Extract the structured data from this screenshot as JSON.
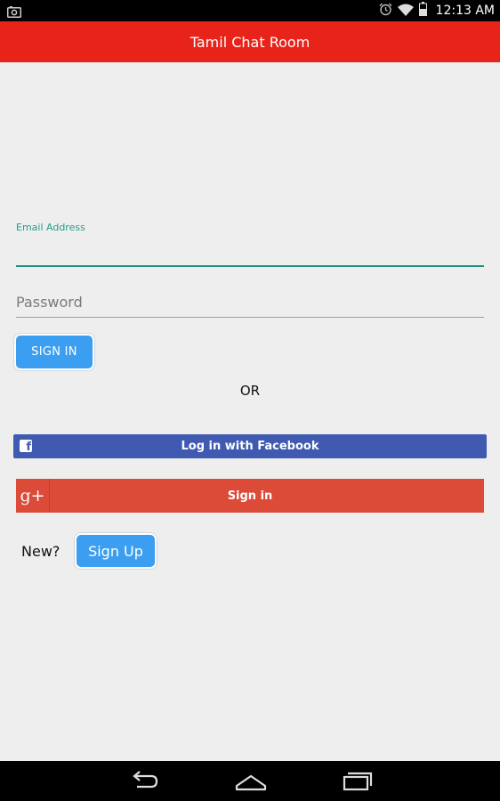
{
  "status_bar": {
    "time": "12:13 AM",
    "icons": [
      "screenshot-icon",
      "alarm-icon",
      "wifi-icon",
      "battery-icon"
    ]
  },
  "app_bar": {
    "title": "Tamil Chat Room",
    "color": "#e8231a"
  },
  "form": {
    "email": {
      "label": "Email Address",
      "value": "",
      "accent": "#1e9e8a"
    },
    "password": {
      "placeholder": "Password",
      "value": ""
    },
    "sign_in_label": "SIGN IN",
    "or_label": "OR"
  },
  "social": {
    "facebook_label": "Log in with Facebook",
    "facebook_color": "#3f5ab0",
    "google_label": "Sign in",
    "google_icon_text": "g+",
    "google_color": "#dc4a38"
  },
  "signup": {
    "prompt": "New?",
    "button_label": "Sign Up",
    "button_color": "#3b9ef0"
  },
  "nav_bar": {
    "buttons": [
      "back-icon",
      "home-icon",
      "recents-icon"
    ]
  }
}
